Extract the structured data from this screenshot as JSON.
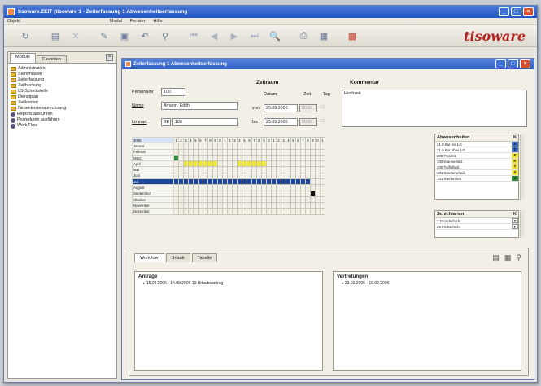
{
  "window": {
    "title": "tisoware.ZEIT (tisoware 1 - Zeiterfassung 1 Abwesenheitserfassung"
  },
  "menu": [
    "Objekt",
    "Modul",
    "Fenster",
    "Hilfe"
  ],
  "toolbar_icons": [
    "refresh-icon",
    "new-icon",
    "delete-icon",
    "edit-icon",
    "save-icon",
    "undo-icon",
    "filter-icon",
    "first-icon",
    "prev-icon",
    "next-icon",
    "last-icon",
    "search-icon",
    "print-icon",
    "calendar-icon",
    "exit-icon"
  ],
  "brand": {
    "logo": "tisoware"
  },
  "left_panel": {
    "tabs": [
      "Module",
      "Favoriten"
    ],
    "tree": [
      {
        "label": "Administration",
        "icon": "folder"
      },
      {
        "label": "Stammdaten",
        "icon": "folder"
      },
      {
        "label": "Zeiterfassung",
        "icon": "folder"
      },
      {
        "label": "Zeitbuchung",
        "icon": "folder"
      },
      {
        "label": "LS-Schnittstelle",
        "icon": "folder"
      },
      {
        "label": "Dienstplan",
        "icon": "folder"
      },
      {
        "label": "Zeitkonten",
        "icon": "folder"
      },
      {
        "label": "Nebenkostenabrechnung",
        "icon": "folder"
      },
      {
        "label": "Reports ausführen",
        "icon": "gear"
      },
      {
        "label": "Prozeduren ausführen",
        "icon": "gear"
      },
      {
        "label": "Work Flow",
        "icon": "gear"
      }
    ]
  },
  "child_window": {
    "title": "Zeiterfassung 1 Abwesenheitserfassung"
  },
  "form": {
    "personal_label": "Personalnr",
    "personal_value": "100",
    "name_label": "Name",
    "name_value": "Amann, Edith",
    "lohnart_label": "Lohnart",
    "lohnart_code": "BE",
    "lohnart_value": "100",
    "zeitraum_header": "Zeitraum",
    "datum_label": "Datum",
    "zeit_label": "Zeit",
    "tag_label": "Tag",
    "von_label": "von",
    "von_datum": "25.09.2006",
    "von_zeit": "00:00",
    "bis_label": "bis",
    "bis_datum": "25.09.2006",
    "bis_zeit": "00:00",
    "kommentar_header": "Kommentar",
    "kommentar_value": "Hochzeit"
  },
  "calendar": {
    "year": "2006",
    "day_header": [
      "1",
      "2",
      "3",
      "4",
      "5",
      "6",
      "7",
      "8",
      "9",
      "0",
      "1",
      "2",
      "3",
      "4",
      "5",
      "6",
      "7",
      "8",
      "9",
      "0",
      "1",
      "2",
      "3",
      "4",
      "5",
      "6",
      "7",
      "8",
      "9",
      "0",
      "1"
    ],
    "months": [
      "Januar",
      "Februar",
      "März",
      "April",
      "Mai",
      "Juni",
      "Juli",
      "August",
      "September",
      "Oktober",
      "November",
      "Dezember"
    ],
    "selected_month": "Juli"
  },
  "absences": {
    "header": "Abwesenheiten",
    "col": "K",
    "rows": [
      {
        "label": "21.0 Kur mit LG",
        "code": "E",
        "color": "#3a6fd0"
      },
      {
        "label": "21.0 Kur ohne LG",
        "code": "E",
        "color": "#3a6fd0"
      },
      {
        "label": "200 Freizeit",
        "code": "F",
        "color": "#f1e63a"
      },
      {
        "label": "100 Krankenstd.",
        "code": "K",
        "color": "#f1e63a"
      },
      {
        "label": "100 Todfallstd.",
        "code": "T",
        "color": "#f1e63a"
      },
      {
        "label": "101 Sonderurlaub",
        "code": "S",
        "color": "#f1e63a"
      },
      {
        "label": "101 Sterbetrieb",
        "code": "U",
        "color": "#2c8a36"
      }
    ]
  },
  "shifts": {
    "header": "Schichtarten",
    "col": "K",
    "rows": [
      {
        "label": "7 Grundschicht",
        "code": "T"
      },
      {
        "label": "25 Frühschicht",
        "code": "F"
      }
    ]
  },
  "bottom": {
    "tabs": [
      "Workflow",
      "Urlaub",
      "Tabelle"
    ],
    "antraege_header": "Anträge",
    "antraege_item": "15.09.2006 - 14.09.2006 10 Urlaubsantrag",
    "vertretungen_header": "Vertretungen",
    "vertretungen_item": "23.01.2006 - 10.02.2006"
  }
}
